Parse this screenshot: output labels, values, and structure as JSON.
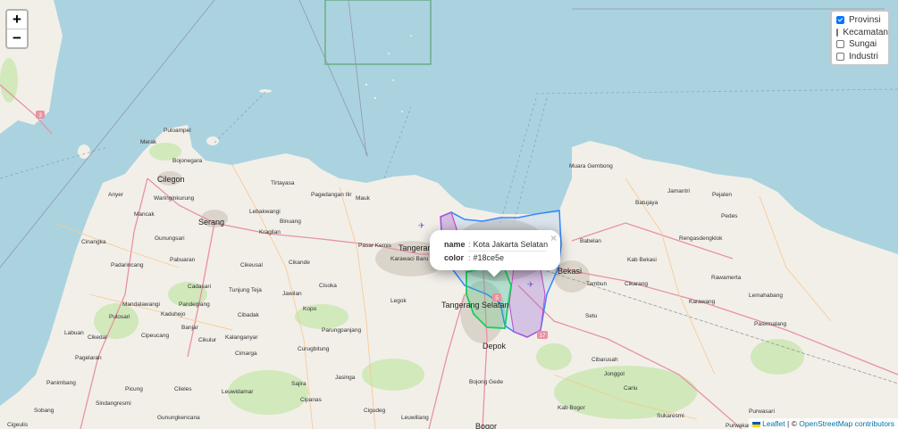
{
  "map": {
    "places": [
      {
        "id": "pulo-ampel",
        "name": "Puloampel"
      },
      {
        "id": "merak",
        "name": "Merak"
      },
      {
        "id": "bojonegara",
        "name": "Bojonegara"
      },
      {
        "id": "cilegon",
        "name": "Cilegon"
      },
      {
        "id": "anyer",
        "name": "Anyer"
      },
      {
        "id": "waringinkurung",
        "name": "Waringinkurung"
      },
      {
        "id": "mancak",
        "name": "Mancak"
      },
      {
        "id": "serang",
        "name": "Serang"
      },
      {
        "id": "cinangka",
        "name": "Cinangka"
      },
      {
        "id": "padarincang",
        "name": "Padarincang"
      },
      {
        "id": "pabuaran",
        "name": "Pabuaran"
      },
      {
        "id": "gunungsari",
        "name": "Gunungsari"
      },
      {
        "id": "tirtayasa",
        "name": "Tirtayasa"
      },
      {
        "id": "lebakwangi",
        "name": "Lebakwangi"
      },
      {
        "id": "binuang",
        "name": "Binuang"
      },
      {
        "id": "pagedangan-ilir",
        "name": "Pagedangan Ilir"
      },
      {
        "id": "mauk",
        "name": "Mauk"
      },
      {
        "id": "kragilan",
        "name": "Kragilan"
      },
      {
        "id": "pasar-kemis",
        "name": "Pasar Kemis"
      },
      {
        "id": "tangerang",
        "name": "Tangerang"
      },
      {
        "id": "karawaci-baru",
        "name": "Karawaci Baru"
      },
      {
        "id": "cikande",
        "name": "Cikande"
      },
      {
        "id": "cikeusal",
        "name": "Cikeusal"
      },
      {
        "id": "cadasari",
        "name": "Cadasari"
      },
      {
        "id": "tunjung-teja",
        "name": "Tunjung Teja"
      },
      {
        "id": "jawilan",
        "name": "Jawilan"
      },
      {
        "id": "cisoka",
        "name": "Cisoka"
      },
      {
        "id": "legok",
        "name": "Legok"
      },
      {
        "id": "tangerang-selatan",
        "name": "Tangerang Selatan"
      },
      {
        "id": "mandalawangi",
        "name": "Mandalawangi"
      },
      {
        "id": "pandeglang",
        "name": "Pandeglang"
      },
      {
        "id": "kaduhejo",
        "name": "Kaduhejo"
      },
      {
        "id": "cibadak",
        "name": "Cibadak"
      },
      {
        "id": "parung-panjang",
        "name": "Parungpanjang"
      },
      {
        "id": "kopo",
        "name": "Kopo"
      },
      {
        "id": "pulosari",
        "name": "Pulosari"
      },
      {
        "id": "labuan",
        "name": "Labuan"
      },
      {
        "id": "cikedal",
        "name": "Cikedal"
      },
      {
        "id": "cipeucang",
        "name": "Cipeucang"
      },
      {
        "id": "banjar",
        "name": "Banjar"
      },
      {
        "id": "cikulur",
        "name": "Cikulur"
      },
      {
        "id": "kalanganyar",
        "name": "Kalanganyar"
      },
      {
        "id": "curugbitung",
        "name": "Curugbitung"
      },
      {
        "id": "cimarga",
        "name": "Cimarga"
      },
      {
        "id": "pagelaran",
        "name": "Pagelaran"
      },
      {
        "id": "picung",
        "name": "Picung"
      },
      {
        "id": "cileles",
        "name": "Cileles"
      },
      {
        "id": "leuwidamar",
        "name": "Leuwidamar"
      },
      {
        "id": "jasinga",
        "name": "Jasinga"
      },
      {
        "id": "sajira",
        "name": "Sajira"
      },
      {
        "id": "cipanas",
        "name": "Cipanas"
      },
      {
        "id": "panimbang",
        "name": "Panimbang"
      },
      {
        "id": "sindangresmi",
        "name": "Sindangresmi"
      },
      {
        "id": "gunungkencana",
        "name": "Gunungkencana"
      },
      {
        "id": "sobang",
        "name": "Sobang"
      },
      {
        "id": "cigeulis",
        "name": "Cigeulis"
      },
      {
        "id": "cigudeg",
        "name": "Cigudeg"
      },
      {
        "id": "leuwiliang",
        "name": "Leuwiliang"
      },
      {
        "id": "depok",
        "name": "Depok"
      },
      {
        "id": "bojong-gede",
        "name": "Bojong Gede"
      },
      {
        "id": "bogor",
        "name": "Bogor"
      },
      {
        "id": "bekasi",
        "name": "Bekasi"
      },
      {
        "id": "babelan",
        "name": "Babelan"
      },
      {
        "id": "muara-gembong",
        "name": "Muara Gembong"
      },
      {
        "id": "jamantri",
        "name": "Jamantri"
      },
      {
        "id": "pejaten",
        "name": "Pejaten"
      },
      {
        "id": "batujaya",
        "name": "Batujaya"
      },
      {
        "id": "pedes",
        "name": "Pedes"
      },
      {
        "id": "rengasdengklok",
        "name": "Rengasdengklok"
      },
      {
        "id": "kab-bekasi",
        "name": "Kab Bekasi"
      },
      {
        "id": "tambun",
        "name": "Tambun"
      },
      {
        "id": "cikarang",
        "name": "Cikarang"
      },
      {
        "id": "rawamerta",
        "name": "Rawamerta"
      },
      {
        "id": "lemahabang",
        "name": "Lemahabang"
      },
      {
        "id": "karawang",
        "name": "Karawang"
      },
      {
        "id": "pasirmalang",
        "name": "Pasirmalang"
      },
      {
        "id": "setu",
        "name": "Setu"
      },
      {
        "id": "cibarusah",
        "name": "Cibarusah"
      },
      {
        "id": "jonggol",
        "name": "Jonggol"
      },
      {
        "id": "cariu",
        "name": "Cariu"
      },
      {
        "id": "kab-bogor",
        "name": "Kab Bogor"
      },
      {
        "id": "purwakarta",
        "name": "Purwakarta"
      },
      {
        "id": "purwasari",
        "name": "Purwasari"
      },
      {
        "id": "sukaresmi",
        "name": "Sukaresmi"
      }
    ],
    "road_shields": [
      "3",
      "5",
      "17"
    ],
    "colors": {
      "water": "#aad3df",
      "land": "#f2efe9",
      "province_outline": "#3388ff",
      "selected_region": "#18ce5e",
      "magenta_region": "#c447c4",
      "highway": "#e892a2"
    }
  },
  "zoom": {
    "in": "+",
    "out": "−"
  },
  "layers": [
    {
      "label": "Provinsi",
      "checked": true
    },
    {
      "label": "Kecamatan",
      "checked": false
    },
    {
      "label": "Sungai",
      "checked": false
    },
    {
      "label": "Industri",
      "checked": false
    }
  ],
  "popup": {
    "close": "×",
    "rows": [
      {
        "key": "name",
        "value": "Kota Jakarta Selatan"
      },
      {
        "key": "color",
        "value": "#18ce5e"
      }
    ]
  },
  "attribution": {
    "leaflet": "Leaflet",
    "separator": " | © ",
    "osm": "OpenStreetMap contributors"
  }
}
